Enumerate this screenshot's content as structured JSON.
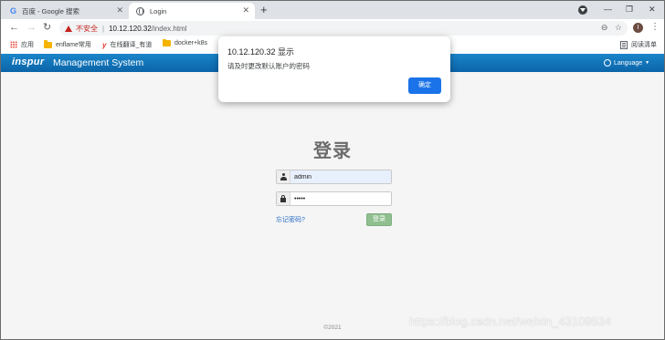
{
  "browser": {
    "tabs": [
      {
        "title": "百度 - Google 搜索",
        "close": "✕"
      },
      {
        "title": "Login",
        "close": "✕"
      }
    ],
    "new_tab": "+",
    "address": {
      "security": "不安全",
      "host": "10.12.120.32",
      "path": "/index.html"
    },
    "avatar_letter": "I",
    "bookmarks": [
      {
        "label": "应用",
        "icon": "apps-icon"
      },
      {
        "label": "enflame常用",
        "icon": "folder-icon"
      },
      {
        "label": "在线翻译_有道",
        "icon": "youdao-icon"
      },
      {
        "label": "docker+k8s",
        "icon": "folder-icon"
      }
    ],
    "reading_list": "阅读清单"
  },
  "site": {
    "logo": "inspur",
    "system_name": "Management System",
    "language_label": "Language"
  },
  "login": {
    "title": "登录",
    "username": "admin",
    "password": "•••••",
    "forgot": "忘记密码?",
    "submit": "登录"
  },
  "footer": "©2021",
  "watermark": "https://blog.csdn.net/weixin_43109534",
  "dialog": {
    "title": "10.12.120.32 显示",
    "message": "请及时更改默认账户的密码",
    "ok": "确定"
  },
  "colors": {
    "header": "#0b64a8",
    "ok_button": "#1a73e8",
    "login_button": "#8fbf8f"
  }
}
